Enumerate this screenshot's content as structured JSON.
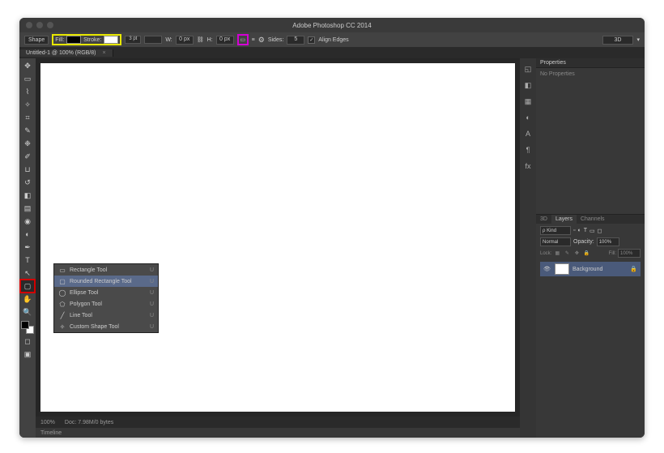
{
  "app": {
    "title": "Adobe Photoshop CC 2014"
  },
  "options": {
    "shape_mode": "Shape",
    "fill_label": "Fill:",
    "stroke_label": "Stroke:",
    "stroke_width": "3 pt",
    "w_label": "W:",
    "w_value": "0 px",
    "h_label": "H:",
    "h_value": "0 px",
    "link_icon": "⛓",
    "path_ops_icon": "▭",
    "align_icon": "≡",
    "sides_label": "Sides:",
    "sides_value": "5",
    "align_edges_label": "Align Edges",
    "btn_3d": "3D"
  },
  "document": {
    "tab": "Untitled-1 @ 100% (RGB/8)",
    "zoom": "100%",
    "doc_info": "Doc: 7.98M/0 bytes",
    "timeline": "Timeline"
  },
  "flyout": {
    "items": [
      {
        "icon": "▭",
        "label": "Rectangle Tool",
        "key": "U"
      },
      {
        "icon": "▢",
        "label": "Rounded Rectangle Tool",
        "key": "U",
        "selected": true
      },
      {
        "icon": "◯",
        "label": "Ellipse Tool",
        "key": "U"
      },
      {
        "icon": "⬠",
        "label": "Polygon Tool",
        "key": "U"
      },
      {
        "icon": "╱",
        "label": "Line Tool",
        "key": "U"
      },
      {
        "icon": "✧",
        "label": "Custom Shape Tool",
        "key": "U"
      }
    ]
  },
  "panels": {
    "properties_title": "Properties",
    "no_properties": "No Properties",
    "tabs": {
      "3d": "3D",
      "layers": "Layers",
      "channels": "Channels"
    },
    "kind_label": "ρ Kind",
    "blend_mode": "Normal",
    "opacity_label": "Opacity:",
    "opacity_value": "100%",
    "lock_label": "Lock:",
    "fill_label": "Fill:",
    "fill_value": "100%",
    "layer": {
      "name": "Background"
    }
  }
}
